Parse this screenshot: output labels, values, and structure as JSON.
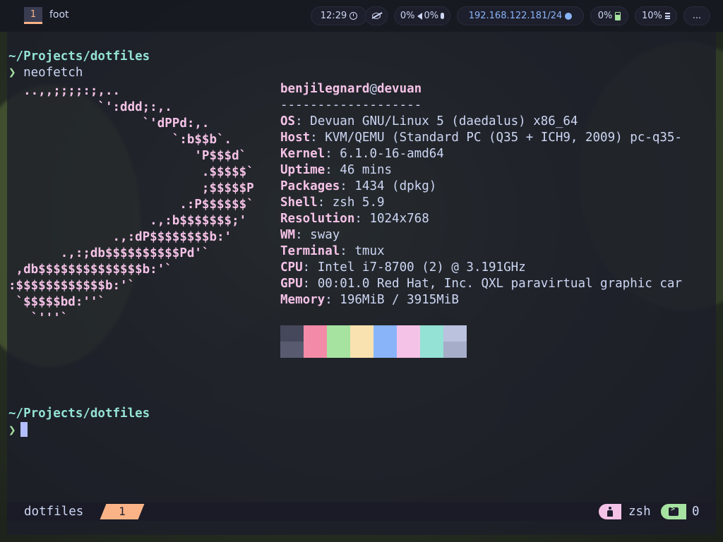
{
  "topbar": {
    "workspace": "1",
    "window_title": "foot",
    "clock": "12:29",
    "volume": "0%",
    "mic": "0%",
    "network": "192.168.122.181/24",
    "battery": "0%",
    "cpu": "10%",
    "more": "..."
  },
  "terminal": {
    "cwd": "~/Projects/dotfiles",
    "prompt_symbol": "❯",
    "command": "neofetch",
    "logo": [
      "  ..,,;;;;:;,..",
      "            `':ddd;:,.",
      "                  `'dPPd:,.",
      "                      `:b$$b`.",
      "                         'P$$$d`",
      "                          .$$$$$`",
      "                          ;$$$$$P",
      "                       .:P$$$$$$`",
      "                   .,:b$$$$$$$;'",
      "              .,:dP$$$$$$$$b:'",
      "       .,:;db$$$$$$$$$$Pd'`",
      " ,db$$$$$$$$$$$$$$b:'`",
      ":$$$$$$$$$$$$b:'`",
      " `$$$$$bd:''`",
      "   `'''`"
    ],
    "user": "benjilegnard",
    "at": "@",
    "host": "devuan",
    "separator": "-------------------",
    "info": [
      {
        "key": "OS",
        "value": "Devuan GNU/Linux 5 (daedalus) x86_64"
      },
      {
        "key": "Host",
        "value": "KVM/QEMU (Standard PC (Q35 + ICH9, 2009) pc-q35-"
      },
      {
        "key": "Kernel",
        "value": "6.1.0-16-amd64"
      },
      {
        "key": "Uptime",
        "value": "46 mins"
      },
      {
        "key": "Packages",
        "value": "1434 (dpkg)"
      },
      {
        "key": "Shell",
        "value": "zsh 5.9"
      },
      {
        "key": "Resolution",
        "value": "1024x768"
      },
      {
        "key": "WM",
        "value": "sway"
      },
      {
        "key": "Terminal",
        "value": "tmux"
      },
      {
        "key": "CPU",
        "value": "Intel i7-8700 (2) @ 3.191GHz"
      },
      {
        "key": "GPU",
        "value": "00:01.0 Red Hat, Inc. QXL paravirtual graphic car"
      },
      {
        "key": "Memory",
        "value": "196MiB / 3915MiB"
      }
    ],
    "palette_top": [
      "#45475a",
      "#f38ba8",
      "#a6e3a1",
      "#f9e2af",
      "#89b4fa",
      "#f5c2e7",
      "#94e2d5",
      "#bac2de"
    ],
    "palette_bottom": [
      "#585b70",
      "#f38ba8",
      "#a6e3a1",
      "#f9e2af",
      "#89b4fa",
      "#f5c2e7",
      "#94e2d5",
      "#a6adc8"
    ]
  },
  "tmux": {
    "session": "dotfiles",
    "window_index": "1",
    "pane_command": "zsh",
    "window_count": "0"
  }
}
